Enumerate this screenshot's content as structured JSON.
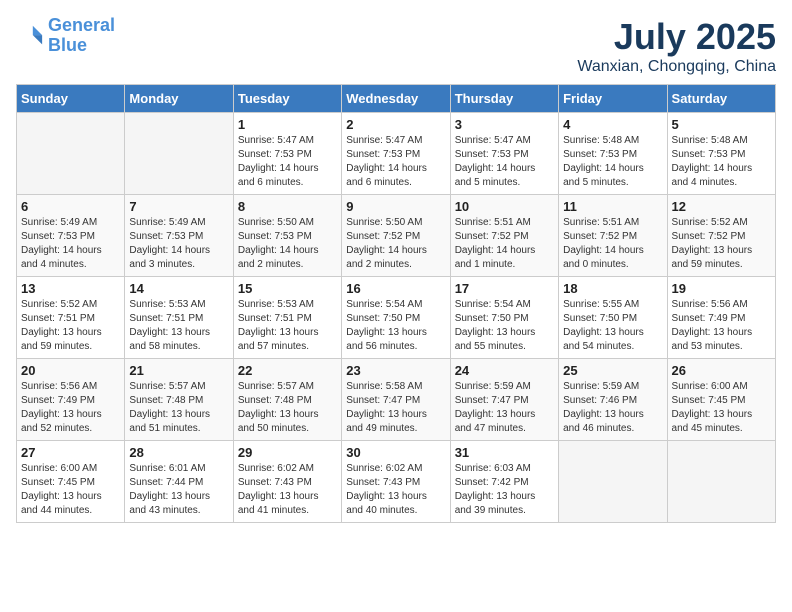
{
  "header": {
    "logo_line1": "General",
    "logo_line2": "Blue",
    "month_title": "July 2025",
    "location": "Wanxian, Chongqing, China"
  },
  "days_of_week": [
    "Sunday",
    "Monday",
    "Tuesday",
    "Wednesday",
    "Thursday",
    "Friday",
    "Saturday"
  ],
  "weeks": [
    [
      {
        "day": "",
        "empty": true
      },
      {
        "day": "",
        "empty": true
      },
      {
        "day": "1",
        "sunrise": "Sunrise: 5:47 AM",
        "sunset": "Sunset: 7:53 PM",
        "daylight": "Daylight: 14 hours and 6 minutes."
      },
      {
        "day": "2",
        "sunrise": "Sunrise: 5:47 AM",
        "sunset": "Sunset: 7:53 PM",
        "daylight": "Daylight: 14 hours and 6 minutes."
      },
      {
        "day": "3",
        "sunrise": "Sunrise: 5:47 AM",
        "sunset": "Sunset: 7:53 PM",
        "daylight": "Daylight: 14 hours and 5 minutes."
      },
      {
        "day": "4",
        "sunrise": "Sunrise: 5:48 AM",
        "sunset": "Sunset: 7:53 PM",
        "daylight": "Daylight: 14 hours and 5 minutes."
      },
      {
        "day": "5",
        "sunrise": "Sunrise: 5:48 AM",
        "sunset": "Sunset: 7:53 PM",
        "daylight": "Daylight: 14 hours and 4 minutes."
      }
    ],
    [
      {
        "day": "6",
        "sunrise": "Sunrise: 5:49 AM",
        "sunset": "Sunset: 7:53 PM",
        "daylight": "Daylight: 14 hours and 4 minutes."
      },
      {
        "day": "7",
        "sunrise": "Sunrise: 5:49 AM",
        "sunset": "Sunset: 7:53 PM",
        "daylight": "Daylight: 14 hours and 3 minutes."
      },
      {
        "day": "8",
        "sunrise": "Sunrise: 5:50 AM",
        "sunset": "Sunset: 7:53 PM",
        "daylight": "Daylight: 14 hours and 2 minutes."
      },
      {
        "day": "9",
        "sunrise": "Sunrise: 5:50 AM",
        "sunset": "Sunset: 7:52 PM",
        "daylight": "Daylight: 14 hours and 2 minutes."
      },
      {
        "day": "10",
        "sunrise": "Sunrise: 5:51 AM",
        "sunset": "Sunset: 7:52 PM",
        "daylight": "Daylight: 14 hours and 1 minute."
      },
      {
        "day": "11",
        "sunrise": "Sunrise: 5:51 AM",
        "sunset": "Sunset: 7:52 PM",
        "daylight": "Daylight: 14 hours and 0 minutes."
      },
      {
        "day": "12",
        "sunrise": "Sunrise: 5:52 AM",
        "sunset": "Sunset: 7:52 PM",
        "daylight": "Daylight: 13 hours and 59 minutes."
      }
    ],
    [
      {
        "day": "13",
        "sunrise": "Sunrise: 5:52 AM",
        "sunset": "Sunset: 7:51 PM",
        "daylight": "Daylight: 13 hours and 59 minutes."
      },
      {
        "day": "14",
        "sunrise": "Sunrise: 5:53 AM",
        "sunset": "Sunset: 7:51 PM",
        "daylight": "Daylight: 13 hours and 58 minutes."
      },
      {
        "day": "15",
        "sunrise": "Sunrise: 5:53 AM",
        "sunset": "Sunset: 7:51 PM",
        "daylight": "Daylight: 13 hours and 57 minutes."
      },
      {
        "day": "16",
        "sunrise": "Sunrise: 5:54 AM",
        "sunset": "Sunset: 7:50 PM",
        "daylight": "Daylight: 13 hours and 56 minutes."
      },
      {
        "day": "17",
        "sunrise": "Sunrise: 5:54 AM",
        "sunset": "Sunset: 7:50 PM",
        "daylight": "Daylight: 13 hours and 55 minutes."
      },
      {
        "day": "18",
        "sunrise": "Sunrise: 5:55 AM",
        "sunset": "Sunset: 7:50 PM",
        "daylight": "Daylight: 13 hours and 54 minutes."
      },
      {
        "day": "19",
        "sunrise": "Sunrise: 5:56 AM",
        "sunset": "Sunset: 7:49 PM",
        "daylight": "Daylight: 13 hours and 53 minutes."
      }
    ],
    [
      {
        "day": "20",
        "sunrise": "Sunrise: 5:56 AM",
        "sunset": "Sunset: 7:49 PM",
        "daylight": "Daylight: 13 hours and 52 minutes."
      },
      {
        "day": "21",
        "sunrise": "Sunrise: 5:57 AM",
        "sunset": "Sunset: 7:48 PM",
        "daylight": "Daylight: 13 hours and 51 minutes."
      },
      {
        "day": "22",
        "sunrise": "Sunrise: 5:57 AM",
        "sunset": "Sunset: 7:48 PM",
        "daylight": "Daylight: 13 hours and 50 minutes."
      },
      {
        "day": "23",
        "sunrise": "Sunrise: 5:58 AM",
        "sunset": "Sunset: 7:47 PM",
        "daylight": "Daylight: 13 hours and 49 minutes."
      },
      {
        "day": "24",
        "sunrise": "Sunrise: 5:59 AM",
        "sunset": "Sunset: 7:47 PM",
        "daylight": "Daylight: 13 hours and 47 minutes."
      },
      {
        "day": "25",
        "sunrise": "Sunrise: 5:59 AM",
        "sunset": "Sunset: 7:46 PM",
        "daylight": "Daylight: 13 hours and 46 minutes."
      },
      {
        "day": "26",
        "sunrise": "Sunrise: 6:00 AM",
        "sunset": "Sunset: 7:45 PM",
        "daylight": "Daylight: 13 hours and 45 minutes."
      }
    ],
    [
      {
        "day": "27",
        "sunrise": "Sunrise: 6:00 AM",
        "sunset": "Sunset: 7:45 PM",
        "daylight": "Daylight: 13 hours and 44 minutes."
      },
      {
        "day": "28",
        "sunrise": "Sunrise: 6:01 AM",
        "sunset": "Sunset: 7:44 PM",
        "daylight": "Daylight: 13 hours and 43 minutes."
      },
      {
        "day": "29",
        "sunrise": "Sunrise: 6:02 AM",
        "sunset": "Sunset: 7:43 PM",
        "daylight": "Daylight: 13 hours and 41 minutes."
      },
      {
        "day": "30",
        "sunrise": "Sunrise: 6:02 AM",
        "sunset": "Sunset: 7:43 PM",
        "daylight": "Daylight: 13 hours and 40 minutes."
      },
      {
        "day": "31",
        "sunrise": "Sunrise: 6:03 AM",
        "sunset": "Sunset: 7:42 PM",
        "daylight": "Daylight: 13 hours and 39 minutes."
      },
      {
        "day": "",
        "empty": true
      },
      {
        "day": "",
        "empty": true
      }
    ]
  ]
}
